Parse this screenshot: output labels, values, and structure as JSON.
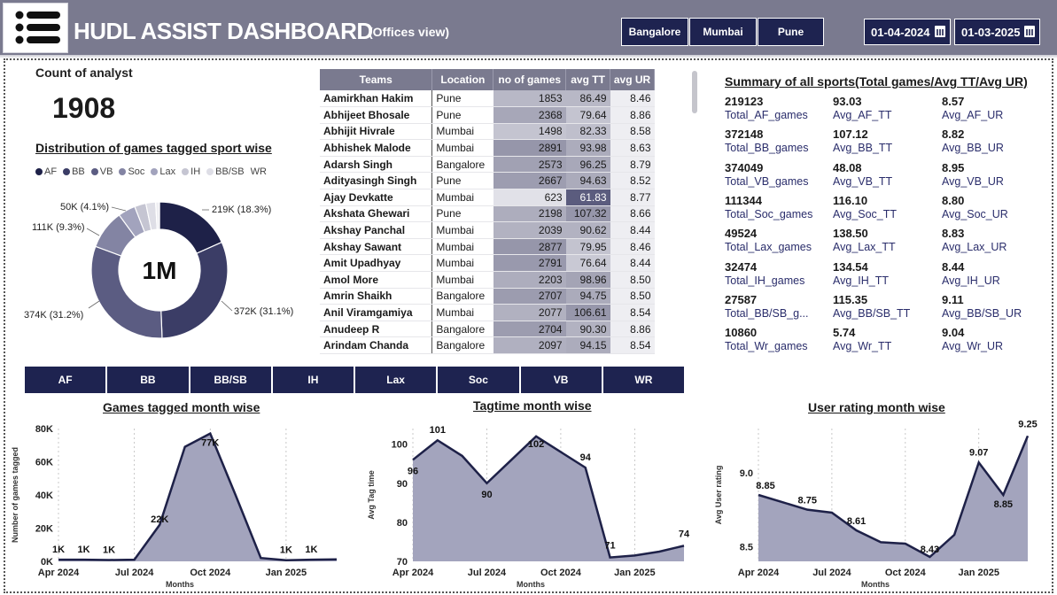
{
  "header": {
    "title": "HUDL ASSIST DASHBOARD",
    "subtitle": "(Offices view)",
    "offices": [
      "Bangalore",
      "Mumbai",
      "Pune"
    ],
    "date_from": "01-04-2024",
    "date_to": "01-03-2025",
    "bg_color": "#7a7a8f",
    "accent": "#1e2350"
  },
  "kpi": {
    "label": "Count of analyst",
    "value": "1908"
  },
  "distribution": {
    "title": "Distribution of games tagged sport wise",
    "center_label": "1M",
    "legend": [
      {
        "name": "AF",
        "color": "#1e2148"
      },
      {
        "name": "BB",
        "color": "#3b3d66"
      },
      {
        "name": "VB",
        "color": "#5b5c82"
      },
      {
        "name": "Soc",
        "color": "#8384a3"
      },
      {
        "name": "Lax",
        "color": "#a2a3bd"
      },
      {
        "name": "IH",
        "color": "#c5c5d2"
      },
      {
        "name": "BB/SB",
        "color": "#dedee6"
      },
      {
        "name": "WR",
        "color": "#efeff3"
      }
    ],
    "labels": [
      "219K (18.3%)",
      "372K (31.1%)",
      "374K (31.2%)",
      "111K (9.3%)",
      "50K (4.1%)"
    ]
  },
  "table": {
    "columns": [
      "Teams",
      "Location",
      "no of games",
      "avg TT",
      "avg UR"
    ],
    "rows": [
      [
        "Aamirkhan Hakim",
        "Pune",
        "1853",
        "86.49",
        "8.46"
      ],
      [
        "Abhijeet Bhosale",
        "Pune",
        "2368",
        "79.64",
        "8.86"
      ],
      [
        "Abhijit Hivrale",
        "Mumbai",
        "1498",
        "82.33",
        "8.58"
      ],
      [
        "Abhishek Malode",
        "Mumbai",
        "2891",
        "93.98",
        "8.63"
      ],
      [
        "Adarsh Singh",
        "Bangalore",
        "2573",
        "96.25",
        "8.79"
      ],
      [
        "Adityasingh Singh",
        "Pune",
        "2667",
        "94.63",
        "8.52"
      ],
      [
        "Ajay Devkatte",
        "Mumbai",
        "623",
        "61.83",
        "8.77"
      ],
      [
        "Akshata Ghewari",
        "Pune",
        "2198",
        "107.32",
        "8.66"
      ],
      [
        "Akshay Panchal",
        "Mumbai",
        "2039",
        "90.62",
        "8.44"
      ],
      [
        "Akshay Sawant",
        "Mumbai",
        "2877",
        "79.95",
        "8.46"
      ],
      [
        "Amit Upadhyay",
        "Mumbai",
        "2791",
        "76.64",
        "8.44"
      ],
      [
        "Amol More",
        "Mumbai",
        "2203",
        "98.96",
        "8.50"
      ],
      [
        "Amrin Shaikh",
        "Bangalore",
        "2707",
        "94.75",
        "8.50"
      ],
      [
        "Anil Viramgamiya",
        "Mumbai",
        "2077",
        "106.61",
        "8.54"
      ],
      [
        "Anudeep R",
        "Bangalore",
        "2704",
        "90.30",
        "8.86"
      ],
      [
        "Arindam Chanda",
        "Bangalore",
        "2097",
        "94.15",
        "8.54"
      ]
    ]
  },
  "summary": {
    "title": "Summary of all sports(Total games/Avg TT/Avg UR)",
    "rows": [
      [
        {
          "v": "219123",
          "l": "Total_AF_games"
        },
        {
          "v": "93.03",
          "l": "Avg_AF_TT"
        },
        {
          "v": "8.57",
          "l": "Avg_AF_UR"
        }
      ],
      [
        {
          "v": "372148",
          "l": "Total_BB_games"
        },
        {
          "v": "107.12",
          "l": "Avg_BB_TT"
        },
        {
          "v": "8.82",
          "l": "Avg_BB_UR"
        }
      ],
      [
        {
          "v": "374049",
          "l": "Total_VB_games"
        },
        {
          "v": "48.08",
          "l": "Avg_VB_TT"
        },
        {
          "v": "8.95",
          "l": "Avg_VB_UR"
        }
      ],
      [
        {
          "v": "111344",
          "l": "Total_Soc_games"
        },
        {
          "v": "116.10",
          "l": "Avg_Soc_TT"
        },
        {
          "v": "8.80",
          "l": "Avg_Soc_UR"
        }
      ],
      [
        {
          "v": "49524",
          "l": "Total_Lax_games"
        },
        {
          "v": "138.50",
          "l": "Avg_Lax_TT"
        },
        {
          "v": "8.83",
          "l": "Avg_Lax_UR"
        }
      ],
      [
        {
          "v": "32474",
          "l": "Total_IH_games"
        },
        {
          "v": "134.54",
          "l": "Avg_IH_TT"
        },
        {
          "v": "8.44",
          "l": "Avg_IH_UR"
        }
      ],
      [
        {
          "v": "27587",
          "l": "Total_BB/SB_g..."
        },
        {
          "v": "115.35",
          "l": "Avg_BB/SB_TT"
        },
        {
          "v": "9.11",
          "l": "Avg_BB/SB_UR"
        }
      ],
      [
        {
          "v": "10860",
          "l": "Total_Wr_games"
        },
        {
          "v": "5.74",
          "l": "Avg_Wr_TT"
        },
        {
          "v": "9.04",
          "l": "Avg_Wr_UR"
        }
      ]
    ]
  },
  "sports": [
    "AF",
    "BB",
    "BB/SB",
    "IH",
    "Lax",
    "Soc",
    "VB",
    "WR"
  ],
  "chart_data": [
    {
      "type": "pie",
      "title": "Distribution of games tagged sport wise",
      "categories": [
        "AF",
        "BB",
        "VB",
        "Soc",
        "Lax",
        "IH",
        "BB/SB",
        "WR"
      ],
      "values": [
        219123,
        372148,
        374049,
        111344,
        49524,
        32474,
        27587,
        10860
      ],
      "center": "1M"
    },
    {
      "type": "area",
      "title": "Games tagged month wise",
      "xlabel": "Months",
      "ylabel": "Number of games tagged",
      "x": [
        "Apr 2024",
        "May 2024",
        "Jun 2024",
        "Jul 2024",
        "Aug 2024",
        "Sep 2024",
        "Oct 2024",
        "Nov 2024",
        "Dec 2024",
        "Jan 2025",
        "Feb 2025",
        "Mar 2025"
      ],
      "values": [
        1000,
        1000,
        800,
        1000,
        22000,
        69000,
        77000,
        40000,
        2000,
        700,
        1000,
        1200
      ],
      "data_labels": [
        "1K",
        "1K",
        "1K",
        "",
        "22K",
        "",
        "77K",
        "",
        "",
        "1K",
        "1K",
        ""
      ],
      "xticks": [
        "Apr 2024",
        "Jul 2024",
        "Oct 2024",
        "Jan 2025"
      ],
      "yticks": [
        "0K",
        "20K",
        "40K",
        "60K",
        "80K"
      ],
      "ylim": [
        0,
        80000
      ]
    },
    {
      "type": "area",
      "title": "Tagtime month wise",
      "xlabel": "Months",
      "ylabel": "Avg Tag time",
      "x": [
        "Apr 2024",
        "May 2024",
        "Jun 2024",
        "Jul 2024",
        "Aug 2024",
        "Sep 2024",
        "Oct 2024",
        "Nov 2024",
        "Dec 2024",
        "Jan 2025",
        "Feb 2025",
        "Mar 2025"
      ],
      "values": [
        96,
        101,
        97,
        90,
        96,
        102,
        98,
        94,
        71,
        71.5,
        72.5,
        74
      ],
      "data_labels": [
        "96",
        "101",
        "",
        "90",
        "",
        "102",
        "",
        "94",
        "71",
        "",
        "",
        "74"
      ],
      "xticks": [
        "Apr 2024",
        "Jul 2024",
        "Oct 2024",
        "Jan 2025"
      ],
      "yticks": [
        "70",
        "80",
        "90",
        "100"
      ],
      "ylim": [
        70,
        104
      ]
    },
    {
      "type": "area",
      "title": "User rating month wise",
      "xlabel": "Months",
      "ylabel": "Avg User rating",
      "x": [
        "Apr 2024",
        "May 2024",
        "Jun 2024",
        "Jul 2024",
        "Aug 2024",
        "Sep 2024",
        "Oct 2024",
        "Nov 2024",
        "Dec 2024",
        "Jan 2025",
        "Feb 2025",
        "Mar 2025"
      ],
      "values": [
        8.85,
        8.8,
        8.75,
        8.73,
        8.61,
        8.53,
        8.52,
        8.43,
        8.58,
        9.07,
        8.85,
        9.25
      ],
      "data_labels": [
        "8.85",
        "",
        "8.75",
        "",
        "8.61",
        "",
        "",
        "8.43",
        "",
        "9.07",
        "8.85",
        "9.25"
      ],
      "xticks": [
        "Apr 2024",
        "Jul 2024",
        "Oct 2024",
        "Jan 2025"
      ],
      "yticks": [
        "8.5",
        "9.0"
      ],
      "ylim": [
        8.4,
        9.3
      ]
    }
  ]
}
